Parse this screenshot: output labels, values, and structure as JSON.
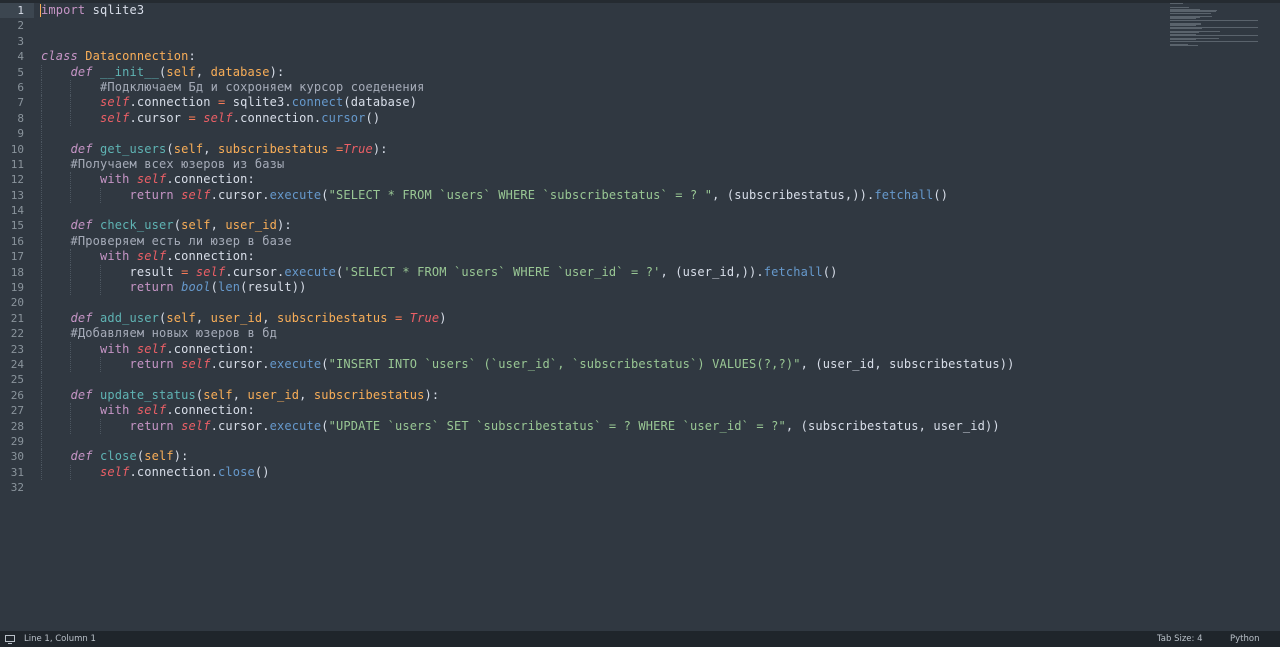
{
  "editor": {
    "line_count": 32,
    "active_line": 1,
    "lines": [
      {
        "n": "1",
        "indent": 0,
        "tokens": [
          {
            "t": "import",
            "c": "k"
          },
          {
            "t": " sqlite3"
          }
        ]
      },
      {
        "n": "2",
        "indent": 0,
        "tokens": []
      },
      {
        "n": "3",
        "indent": 0,
        "tokens": []
      },
      {
        "n": "4",
        "indent": 0,
        "tokens": [
          {
            "t": "class",
            "c": "ki"
          },
          {
            "t": " "
          },
          {
            "t": "Dataconnection",
            "c": "cls"
          },
          {
            "t": ":"
          }
        ]
      },
      {
        "n": "5",
        "indent": 1,
        "tokens": [
          {
            "t": "    "
          },
          {
            "t": "def",
            "c": "ki"
          },
          {
            "t": " "
          },
          {
            "t": "__init__",
            "c": "fn"
          },
          {
            "t": "("
          },
          {
            "t": "self",
            "c": "pr"
          },
          {
            "t": ", "
          },
          {
            "t": "database",
            "c": "pr"
          },
          {
            "t": "):"
          }
        ]
      },
      {
        "n": "6",
        "indent": 2,
        "tokens": [
          {
            "t": "        "
          },
          {
            "t": "#Подключаем Бд и сохроняем курсор соеденения",
            "c": "cm"
          }
        ]
      },
      {
        "n": "7",
        "indent": 2,
        "tokens": [
          {
            "t": "        "
          },
          {
            "t": "self",
            "c": "slf"
          },
          {
            "t": ".connection "
          },
          {
            "t": "=",
            "c": "op"
          },
          {
            "t": " sqlite3."
          },
          {
            "t": "connect",
            "c": "mt"
          },
          {
            "t": "(database)"
          }
        ]
      },
      {
        "n": "8",
        "indent": 2,
        "tokens": [
          {
            "t": "        "
          },
          {
            "t": "self",
            "c": "slf"
          },
          {
            "t": ".cursor "
          },
          {
            "t": "=",
            "c": "op"
          },
          {
            "t": " "
          },
          {
            "t": "self",
            "c": "slf"
          },
          {
            "t": ".connection."
          },
          {
            "t": "cursor",
            "c": "mt"
          },
          {
            "t": "()"
          }
        ]
      },
      {
        "n": "9",
        "indent": 1,
        "tokens": []
      },
      {
        "n": "10",
        "indent": 1,
        "tokens": [
          {
            "t": "    "
          },
          {
            "t": "def",
            "c": "ki"
          },
          {
            "t": " "
          },
          {
            "t": "get_users",
            "c": "fn"
          },
          {
            "t": "("
          },
          {
            "t": "self",
            "c": "pr"
          },
          {
            "t": ", "
          },
          {
            "t": "subscribestatus",
            "c": "pr"
          },
          {
            "t": " "
          },
          {
            "t": "=",
            "c": "op"
          },
          {
            "t": "True",
            "c": "lit"
          },
          {
            "t": "):"
          }
        ]
      },
      {
        "n": "11",
        "indent": 1,
        "tokens": [
          {
            "t": "    "
          },
          {
            "t": "#Получаем всех юзеров из базы",
            "c": "cm"
          }
        ]
      },
      {
        "n": "12",
        "indent": 2,
        "tokens": [
          {
            "t": "        "
          },
          {
            "t": "with",
            "c": "k"
          },
          {
            "t": " "
          },
          {
            "t": "self",
            "c": "slf"
          },
          {
            "t": ".connection:"
          }
        ]
      },
      {
        "n": "13",
        "indent": 3,
        "tokens": [
          {
            "t": "            "
          },
          {
            "t": "return",
            "c": "k"
          },
          {
            "t": " "
          },
          {
            "t": "self",
            "c": "slf"
          },
          {
            "t": ".cursor."
          },
          {
            "t": "execute",
            "c": "mt"
          },
          {
            "t": "("
          },
          {
            "t": "\"SELECT * FROM `users` WHERE `subscribestatus` = ? \"",
            "c": "str"
          },
          {
            "t": ", (subscribestatus,))."
          },
          {
            "t": "fetchall",
            "c": "mt"
          },
          {
            "t": "()"
          }
        ]
      },
      {
        "n": "14",
        "indent": 1,
        "tokens": []
      },
      {
        "n": "15",
        "indent": 1,
        "tokens": [
          {
            "t": "    "
          },
          {
            "t": "def",
            "c": "ki"
          },
          {
            "t": " "
          },
          {
            "t": "check_user",
            "c": "fn"
          },
          {
            "t": "("
          },
          {
            "t": "self",
            "c": "pr"
          },
          {
            "t": ", "
          },
          {
            "t": "user_id",
            "c": "pr"
          },
          {
            "t": "):"
          }
        ]
      },
      {
        "n": "16",
        "indent": 1,
        "tokens": [
          {
            "t": "    "
          },
          {
            "t": "#Проверяем есть ли юзер в базе",
            "c": "cm"
          }
        ]
      },
      {
        "n": "17",
        "indent": 2,
        "tokens": [
          {
            "t": "        "
          },
          {
            "t": "with",
            "c": "k"
          },
          {
            "t": " "
          },
          {
            "t": "self",
            "c": "slf"
          },
          {
            "t": ".connection:"
          }
        ]
      },
      {
        "n": "18",
        "indent": 3,
        "tokens": [
          {
            "t": "            "
          },
          {
            "t": "result "
          },
          {
            "t": "=",
            "c": "op"
          },
          {
            "t": " "
          },
          {
            "t": "self",
            "c": "slf"
          },
          {
            "t": ".cursor."
          },
          {
            "t": "execute",
            "c": "mt"
          },
          {
            "t": "("
          },
          {
            "t": "'SELECT * FROM `users` WHERE `user_id` = ?'",
            "c": "str"
          },
          {
            "t": ", (user_id,))."
          },
          {
            "t": "fetchall",
            "c": "mt"
          },
          {
            "t": "()"
          }
        ]
      },
      {
        "n": "19",
        "indent": 3,
        "tokens": [
          {
            "t": "            "
          },
          {
            "t": "return",
            "c": "k"
          },
          {
            "t": " "
          },
          {
            "t": "bool",
            "c": "bii"
          },
          {
            "t": "("
          },
          {
            "t": "len",
            "c": "bi"
          },
          {
            "t": "(result))"
          }
        ]
      },
      {
        "n": "20",
        "indent": 1,
        "tokens": []
      },
      {
        "n": "21",
        "indent": 1,
        "tokens": [
          {
            "t": "    "
          },
          {
            "t": "def",
            "c": "ki"
          },
          {
            "t": " "
          },
          {
            "t": "add_user",
            "c": "fn"
          },
          {
            "t": "("
          },
          {
            "t": "self",
            "c": "pr"
          },
          {
            "t": ", "
          },
          {
            "t": "user_id",
            "c": "pr"
          },
          {
            "t": ", "
          },
          {
            "t": "subscribestatus",
            "c": "pr"
          },
          {
            "t": " "
          },
          {
            "t": "=",
            "c": "op"
          },
          {
            "t": " "
          },
          {
            "t": "True",
            "c": "lit"
          },
          {
            "t": ")"
          }
        ]
      },
      {
        "n": "22",
        "indent": 1,
        "tokens": [
          {
            "t": "    "
          },
          {
            "t": "#Добавляем новых юзеров в бд",
            "c": "cm"
          }
        ]
      },
      {
        "n": "23",
        "indent": 2,
        "tokens": [
          {
            "t": "        "
          },
          {
            "t": "with",
            "c": "k"
          },
          {
            "t": " "
          },
          {
            "t": "self",
            "c": "slf"
          },
          {
            "t": ".connection:"
          }
        ]
      },
      {
        "n": "24",
        "indent": 3,
        "tokens": [
          {
            "t": "            "
          },
          {
            "t": "return",
            "c": "k"
          },
          {
            "t": " "
          },
          {
            "t": "self",
            "c": "slf"
          },
          {
            "t": ".cursor."
          },
          {
            "t": "execute",
            "c": "mt"
          },
          {
            "t": "("
          },
          {
            "t": "\"INSERT INTO `users` (`user_id`, `subscribestatus`) VALUES(?,?)\"",
            "c": "str"
          },
          {
            "t": ", (user_id, subscribestatus))"
          }
        ]
      },
      {
        "n": "25",
        "indent": 1,
        "tokens": []
      },
      {
        "n": "26",
        "indent": 1,
        "tokens": [
          {
            "t": "    "
          },
          {
            "t": "def",
            "c": "ki"
          },
          {
            "t": " "
          },
          {
            "t": "update_status",
            "c": "fn"
          },
          {
            "t": "("
          },
          {
            "t": "self",
            "c": "pr"
          },
          {
            "t": ", "
          },
          {
            "t": "user_id",
            "c": "pr"
          },
          {
            "t": ", "
          },
          {
            "t": "subscribestatus",
            "c": "pr"
          },
          {
            "t": "):"
          }
        ]
      },
      {
        "n": "27",
        "indent": 2,
        "tokens": [
          {
            "t": "        "
          },
          {
            "t": "with",
            "c": "k"
          },
          {
            "t": " "
          },
          {
            "t": "self",
            "c": "slf"
          },
          {
            "t": ".connection:"
          }
        ]
      },
      {
        "n": "28",
        "indent": 3,
        "tokens": [
          {
            "t": "            "
          },
          {
            "t": "return",
            "c": "k"
          },
          {
            "t": " "
          },
          {
            "t": "self",
            "c": "slf"
          },
          {
            "t": ".cursor."
          },
          {
            "t": "execute",
            "c": "mt"
          },
          {
            "t": "("
          },
          {
            "t": "\"UPDATE `users` SET `subscribestatus` = ? WHERE `user_id` = ?\"",
            "c": "str"
          },
          {
            "t": ", (subscribestatus, user_id))"
          }
        ]
      },
      {
        "n": "29",
        "indent": 1,
        "tokens": []
      },
      {
        "n": "30",
        "indent": 1,
        "tokens": [
          {
            "t": "    "
          },
          {
            "t": "def",
            "c": "ki"
          },
          {
            "t": " "
          },
          {
            "t": "close",
            "c": "fn"
          },
          {
            "t": "("
          },
          {
            "t": "self",
            "c": "pr"
          },
          {
            "t": "):"
          }
        ]
      },
      {
        "n": "31",
        "indent": 2,
        "tokens": [
          {
            "t": "        "
          },
          {
            "t": "self",
            "c": "slf"
          },
          {
            "t": ".connection."
          },
          {
            "t": "close",
            "c": "mt"
          },
          {
            "t": "()"
          }
        ]
      },
      {
        "n": "32",
        "indent": 0,
        "tokens": []
      }
    ]
  },
  "statusbar": {
    "position": "Line 1, Column 1",
    "tab_size": "Tab Size: 4",
    "syntax": "Python"
  },
  "colors": {
    "background": "#303841",
    "keyword": "#c695c6",
    "class_name": "#f9ae58",
    "function": "#5fb4b4",
    "self": "#ec5f66",
    "string": "#99c794",
    "comment": "#a6acb9",
    "method": "#6699cc",
    "operator": "#f97b58"
  },
  "icons": {
    "status_panel": "console-icon"
  }
}
